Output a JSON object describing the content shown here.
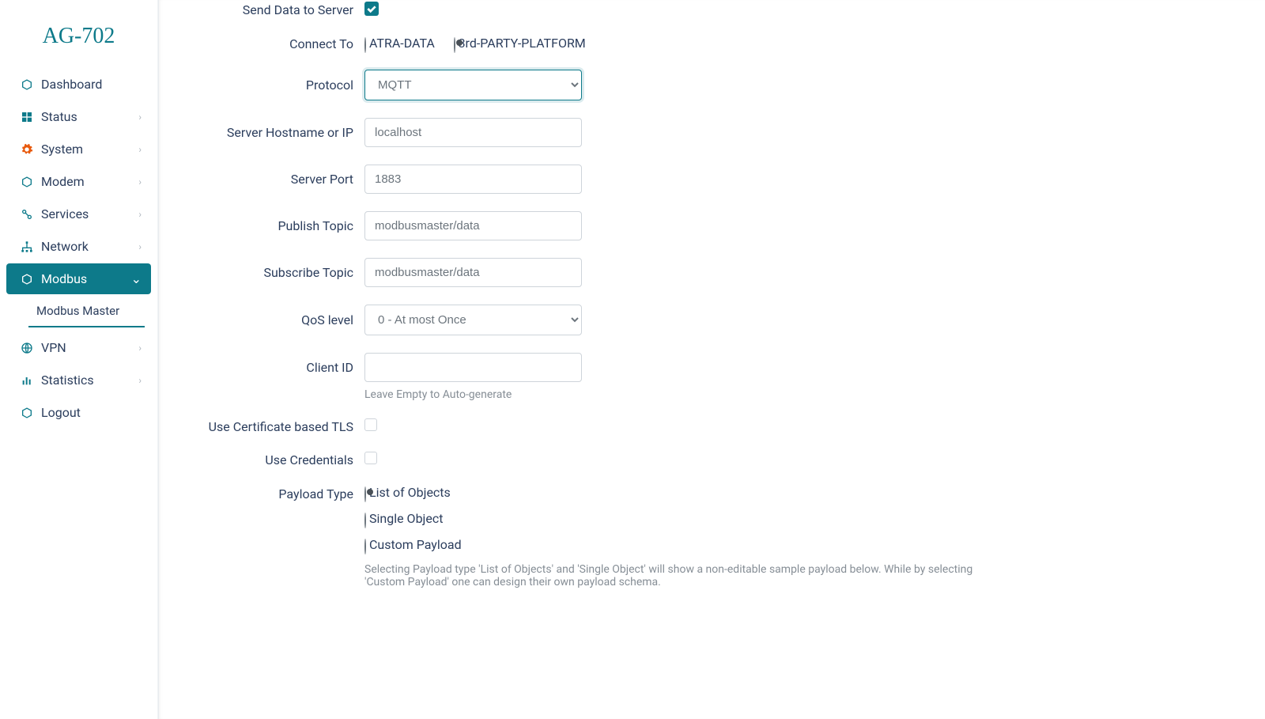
{
  "brand": "AG-702",
  "sidebar": {
    "items": [
      {
        "label": "Dashboard",
        "icon": "box-icon",
        "expandable": false
      },
      {
        "label": "Status",
        "icon": "grid-icon",
        "expandable": true
      },
      {
        "label": "System",
        "icon": "gear-icon",
        "expandable": true,
        "orange": true
      },
      {
        "label": "Modem",
        "icon": "box-icon",
        "expandable": true
      },
      {
        "label": "Services",
        "icon": "link-icon",
        "expandable": true
      },
      {
        "label": "Network",
        "icon": "sitemap-icon",
        "expandable": true
      },
      {
        "label": "Modbus",
        "icon": "box-icon",
        "expandable": true,
        "active": true
      },
      {
        "label": "VPN",
        "icon": "globe-icon",
        "expandable": true
      },
      {
        "label": "Statistics",
        "icon": "bars-icon",
        "expandable": true
      },
      {
        "label": "Logout",
        "icon": "box-icon",
        "expandable": false
      }
    ],
    "sub_item": "Modbus Master"
  },
  "form": {
    "send_data_label": "Send Data to Server",
    "send_data_checked": true,
    "connect_to_label": "Connect To",
    "connect_to_options": [
      "ATRA-DATA",
      "3rd-PARTY-PLATFORM"
    ],
    "connect_to_selected": "3rd-PARTY-PLATFORM",
    "protocol_label": "Protocol",
    "protocol_value": "MQTT",
    "hostname_label": "Server Hostname or IP",
    "hostname_value": "localhost",
    "port_label": "Server Port",
    "port_value": "1883",
    "publish_label": "Publish Topic",
    "publish_value": "modbusmaster/data",
    "subscribe_label": "Subscribe Topic",
    "subscribe_value": "modbusmaster/data",
    "qos_label": "QoS level",
    "qos_value": "0 - At most Once",
    "client_id_label": "Client ID",
    "client_id_value": "",
    "client_id_help": "Leave Empty to Auto-generate",
    "tls_label": "Use Certificate based TLS",
    "tls_checked": false,
    "cred_label": "Use Credentials",
    "cred_checked": false,
    "payload_label": "Payload Type",
    "payload_options": [
      "List of Objects",
      "Single Object",
      "Custom Payload"
    ],
    "payload_selected": "List of Objects",
    "payload_help": "Selecting Payload type 'List of Objects' and 'Single Object' will show a non-editable sample payload below. While by selecting 'Custom Payload' one can design their own payload schema."
  }
}
